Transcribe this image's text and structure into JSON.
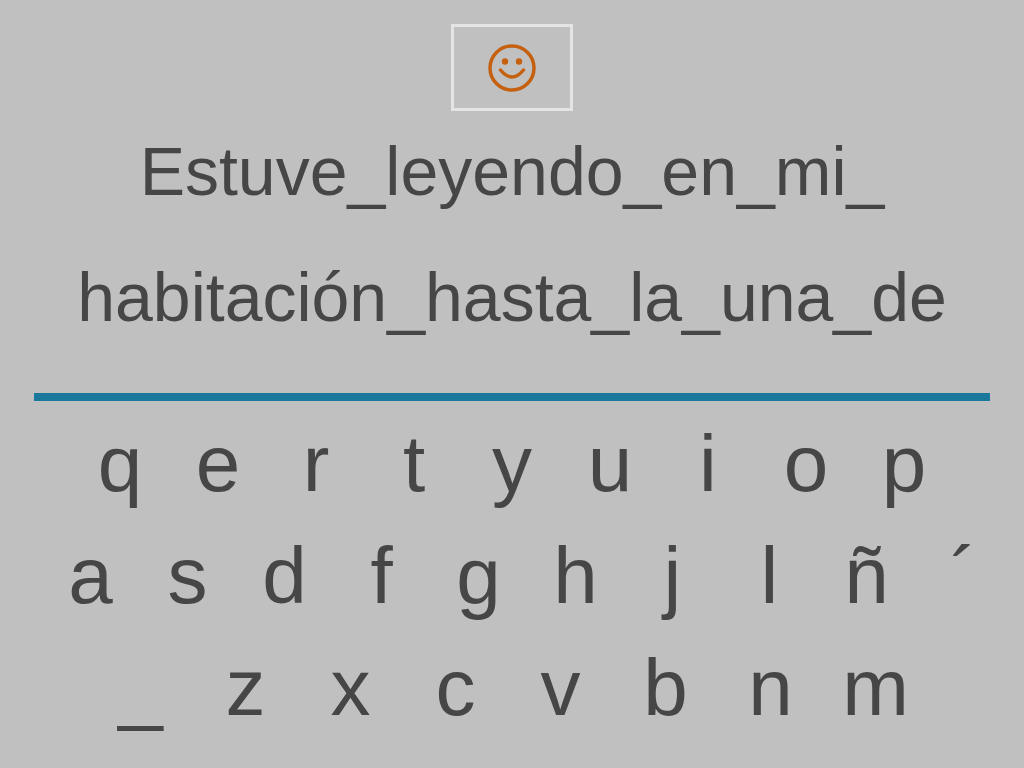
{
  "sentence": {
    "lines": [
      "Estuve_leyendo_en_mi_",
      "habitación_hasta_la_una_de"
    ]
  },
  "keyboard": {
    "rows": [
      [
        "q",
        "e",
        "r",
        "t",
        "y",
        "u",
        "i",
        "o",
        "p"
      ],
      [
        "a",
        "s",
        "d",
        "f",
        "g",
        "h",
        "j",
        "l",
        "ñ",
        "´"
      ],
      [
        "_",
        "z",
        "x",
        "c",
        "v",
        "b",
        "n",
        "m"
      ]
    ]
  }
}
